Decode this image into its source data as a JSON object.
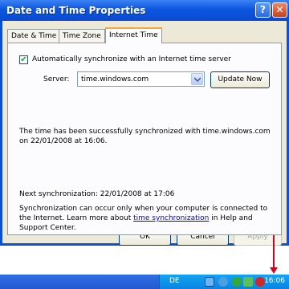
{
  "window": {
    "title": "Date and Time Properties",
    "help_glyph": "?",
    "close_glyph": "✕"
  },
  "tabs": [
    {
      "label": "Date & Time",
      "active": false
    },
    {
      "label": "Time Zone",
      "active": false
    },
    {
      "label": "Internet Time",
      "active": true
    }
  ],
  "panel": {
    "auto_sync": {
      "checked": true,
      "check_glyph": "✔",
      "label": "Automatically synchronize with an Internet time server"
    },
    "server_label": "Server:",
    "server_value": "time.windows.com",
    "update_button": "Update Now",
    "status_message": "The time has been successfully synchronized with time.windows.com on 22/01/2008 at 16:06.",
    "next_sync": "Next synchronization: 22/01/2008 at 17:06",
    "info_before": "Synchronization can occur only when your computer is connected to the Internet.  Learn more about ",
    "info_link": "time synchronization",
    "info_after": " in Help and Support Center."
  },
  "buttons": {
    "ok": "OK",
    "cancel": "Cancel",
    "apply": "Apply"
  },
  "taskbar": {
    "language": "DE",
    "clock": "16:06",
    "tray_icons": [
      "network-icon",
      "volume-icon",
      "security-icon",
      "sync-icon",
      "antivirus-icon"
    ]
  },
  "colors": {
    "title_bar": "#0a4fd8",
    "annotation_arrow": "#e0001a",
    "active_tab_accent": "#f6a838"
  }
}
